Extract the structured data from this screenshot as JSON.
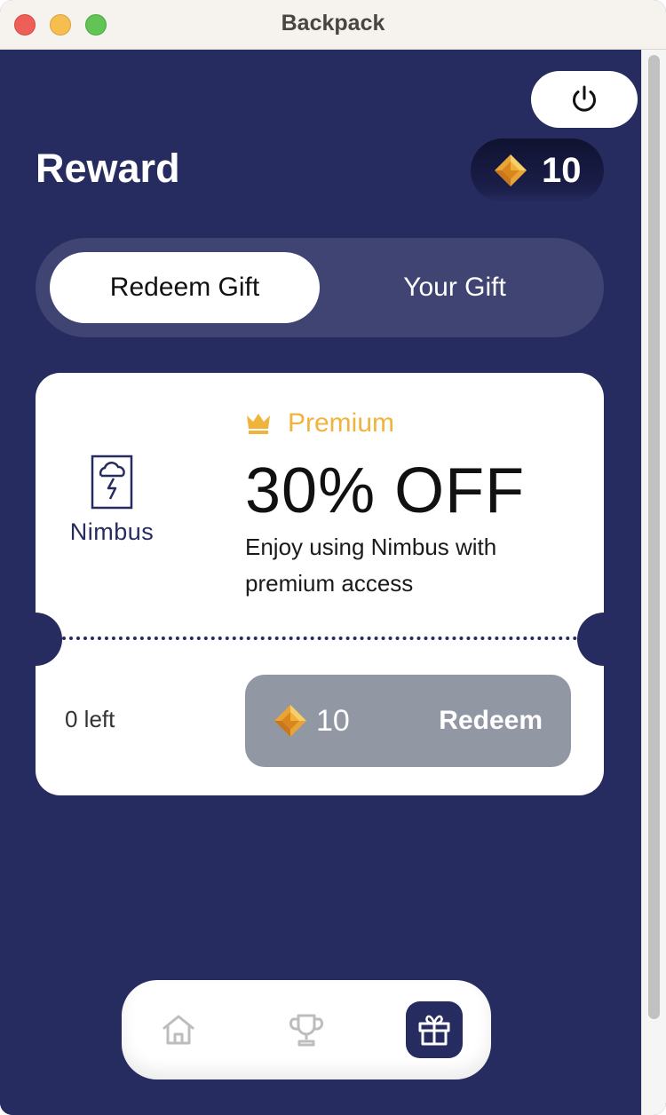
{
  "window": {
    "title": "Backpack"
  },
  "header": {
    "title": "Reward",
    "balance": "10",
    "power_icon": "power-icon",
    "gem_icon": "gem-icon"
  },
  "tabs": [
    {
      "label": "Redeem Gift",
      "active": true
    },
    {
      "label": "Your Gift",
      "active": false
    }
  ],
  "gift_card": {
    "brand": "Nimbus",
    "brand_icon": "cloud-lightning-icon",
    "tier": "Premium",
    "tier_icon": "crown-icon",
    "offer": "30% OFF",
    "description": "Enjoy using Nimbus with premium access",
    "remaining": "0 left",
    "cost": "10",
    "redeem_label": "Redeem"
  },
  "bottom_nav": [
    {
      "name": "home",
      "icon": "home-icon",
      "active": false
    },
    {
      "name": "trophy",
      "icon": "trophy-icon",
      "active": false
    },
    {
      "name": "gift",
      "icon": "gift-icon",
      "active": true
    }
  ],
  "colors": {
    "background": "#262b60",
    "accent_gold": "#f0b43c",
    "redeem_disabled": "#9197a3",
    "tab_track": "#3f4472"
  }
}
